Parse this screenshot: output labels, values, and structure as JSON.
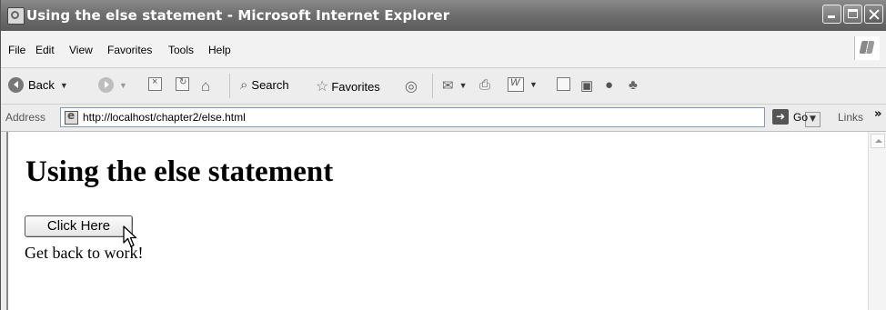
{
  "window": {
    "title": "Using the else statement - Microsoft Internet Explorer"
  },
  "menu": [
    "File",
    "Edit",
    "View",
    "Favorites",
    "Tools",
    "Help"
  ],
  "toolbar": {
    "back_label": "Back",
    "search_label": "Search",
    "favorites_label": "Favorites"
  },
  "address": {
    "label": "Address",
    "url": "http://localhost/chapter2/else.html",
    "go_label": "Go",
    "links_label": "Links",
    "chevron": "»"
  },
  "page": {
    "heading": "Using the else statement",
    "button_label": "Click Here",
    "message": "Get back to work!"
  },
  "icons": [
    "ie-page-icon",
    "minimize-icon",
    "maximize-icon",
    "close-icon",
    "windows-logo-icon",
    "back-icon",
    "forward-icon",
    "stop-icon",
    "refresh-icon",
    "home-icon",
    "search-icon",
    "favorites-star-icon",
    "media-icon",
    "mail-icon",
    "print-icon",
    "word-icon",
    "edit-icon",
    "research-icon",
    "messenger-icon",
    "go-arrow-icon",
    "mouse-cursor-icon"
  ]
}
